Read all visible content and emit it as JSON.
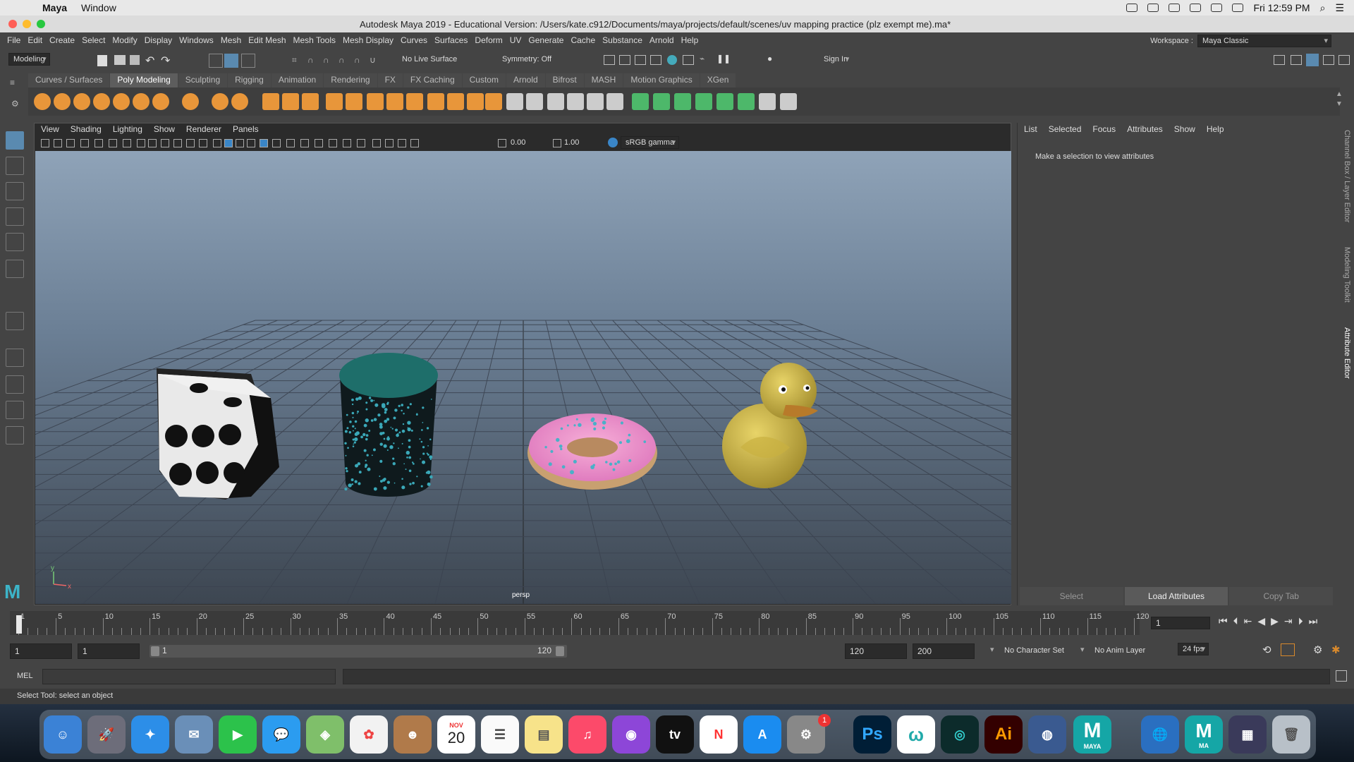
{
  "mac_menubar": {
    "app": "Maya",
    "window": "Window",
    "clock": "Fri 12:59 PM"
  },
  "title": "Autodesk Maya 2019 - Educational Version: /Users/kate.c912/Documents/maya/projects/default/scenes/uv mapping practice (plz exempt me).ma*",
  "main_menu": [
    "File",
    "Edit",
    "Create",
    "Select",
    "Modify",
    "Display",
    "Windows",
    "Mesh",
    "Edit Mesh",
    "Mesh Tools",
    "Mesh Display",
    "Curves",
    "Surfaces",
    "Deform",
    "UV",
    "Generate",
    "Cache",
    "Substance",
    "Arnold",
    "Help"
  ],
  "workspace": {
    "label": "Workspace :",
    "value": "Maya Classic"
  },
  "status_line": {
    "mode": "Modeling",
    "live_surface": "No Live Surface",
    "symmetry": "Symmetry: Off",
    "sign_in": "Sign In"
  },
  "shelf_tabs": [
    "Curves / Surfaces",
    "Poly Modeling",
    "Sculpting",
    "Rigging",
    "Animation",
    "Rendering",
    "FX",
    "FX Caching",
    "Custom",
    "Arnold",
    "Bifrost",
    "MASH",
    "Motion Graphics",
    "XGen"
  ],
  "active_shelf_tab": "Poly Modeling",
  "viewport": {
    "menu": [
      "View",
      "Shading",
      "Lighting",
      "Show",
      "Renderer",
      "Panels"
    ],
    "exposure": "0.00",
    "gamma": "1.00",
    "color_space": "sRGB gamma",
    "camera": "persp",
    "axis_x": "x",
    "axis_y": "y"
  },
  "attribute_editor": {
    "menu": [
      "List",
      "Selected",
      "Focus",
      "Attributes",
      "Show",
      "Help"
    ],
    "message": "Make a selection to view attributes",
    "buttons": [
      "Select",
      "Load Attributes",
      "Copy Tab"
    ]
  },
  "side_tabs": [
    "Channel Box / Layer Editor",
    "Modeling Toolkit",
    "Attribute Editor"
  ],
  "timeline": {
    "ticks": [
      "1",
      "5",
      "10",
      "15",
      "20",
      "25",
      "30",
      "35",
      "40",
      "45",
      "50",
      "55",
      "60",
      "65",
      "70",
      "75",
      "80",
      "85",
      "90",
      "95",
      "100",
      "105",
      "110",
      "115",
      "120"
    ],
    "current_frame": "1"
  },
  "range": {
    "start": "1",
    "playback_start": "1",
    "slider_start": "1",
    "slider_end": "120",
    "playback_end": "120",
    "end": "200",
    "character_set": "No Character Set",
    "anim_layer": "No Anim Layer",
    "fps": "24 fps"
  },
  "command_line": {
    "label": "MEL"
  },
  "help_line": "Select Tool: select an object",
  "dock": {
    "calendar_month": "NOV",
    "calendar_day": "20",
    "notification_badge": "1",
    "maya_label": "MAYA",
    "ma_label": "MA",
    "ps_label": "Ps",
    "ai_label": "Ai"
  }
}
